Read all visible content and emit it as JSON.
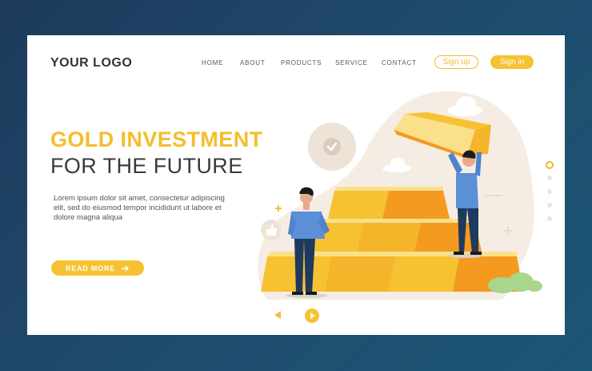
{
  "header": {
    "logo": "YOUR LOGO",
    "nav": [
      "HOME",
      "ABOUT",
      "PRODUCTS",
      "SERVICE",
      "CONTACT"
    ],
    "signup_label": "Sign up",
    "signin_label": "Sign in"
  },
  "hero": {
    "title_line1": "GOLD INVESTMENT",
    "title_line2": "FOR THE FUTURE",
    "body": "Lorem ipsum dolor sit amet, consectetur adipiscing elit, sed do eiusmod tempor incididunt ut labore et dolore magna aliqua",
    "cta_label": "READ MORE"
  },
  "pagination": {
    "total": 5,
    "active_index": 0
  },
  "colors": {
    "accent": "#f4be2c",
    "background": "#1f4d6e",
    "text_dark": "#3a3a3a"
  },
  "icons": [
    "arrow-right-icon",
    "check-icon",
    "thumbs-up-icon",
    "cloud-icon",
    "play-icon",
    "prev-triangle-icon"
  ]
}
